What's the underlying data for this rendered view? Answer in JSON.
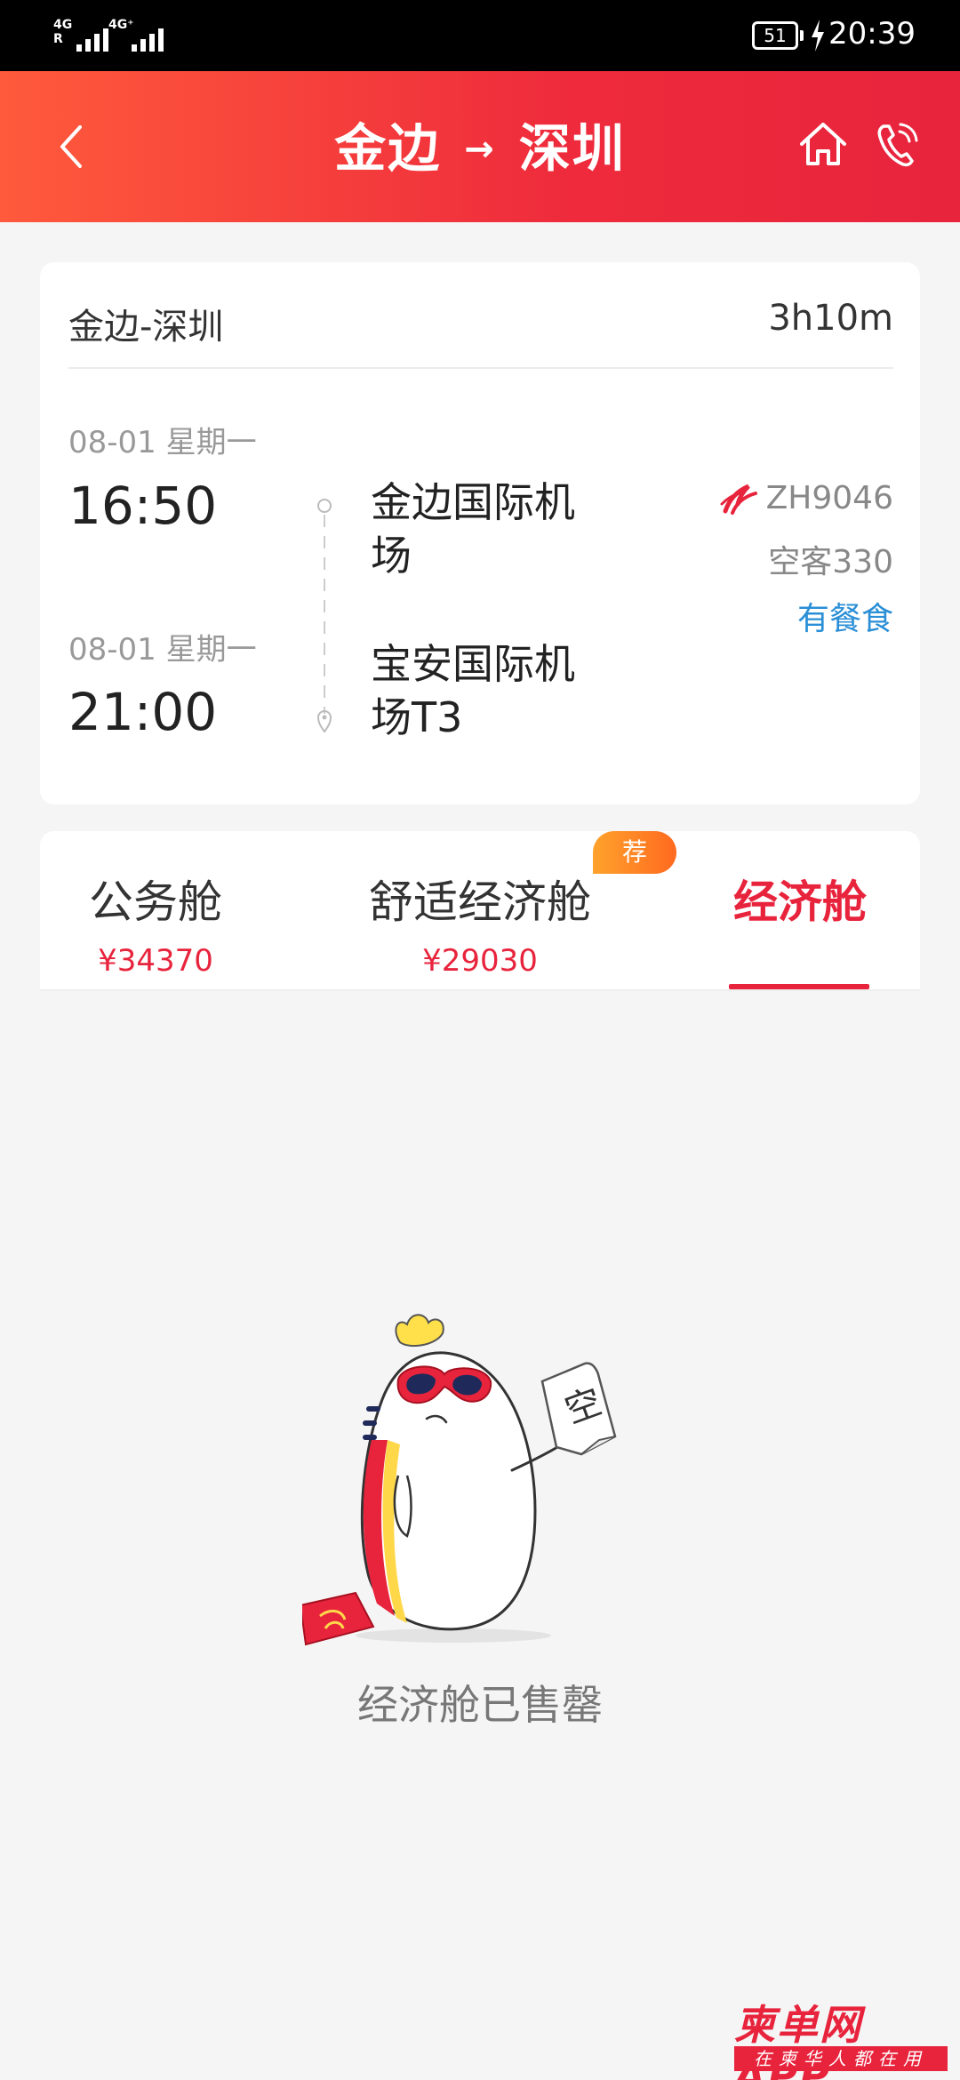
{
  "status_bar": {
    "signal1_label": "4G R",
    "signal2_label": "4G⁺",
    "battery": "51",
    "time": "20:39"
  },
  "header": {
    "origin": "金边",
    "arrow": "→",
    "destination": "深圳"
  },
  "flight": {
    "route": "金边-深圳",
    "duration": "3h10m",
    "departure": {
      "date": "08-01 星期一",
      "time": "16:50",
      "airport_line1": "金边国际机",
      "airport_line2": "场"
    },
    "arrival": {
      "date": "08-01 星期一",
      "time": "21:00",
      "airport_line1": "宝安国际机",
      "airport_line2": "场T3"
    },
    "flight_no": "ZH9046",
    "aircraft": "空客330",
    "meal": "有餐食"
  },
  "cabins": {
    "badge": "荐",
    "tabs": [
      {
        "name": "公务舱",
        "price": "¥34370"
      },
      {
        "name": "舒适经济舱",
        "price": "¥29030"
      },
      {
        "name": "经济舱",
        "price": ""
      }
    ]
  },
  "empty_state": {
    "sign_text": "空",
    "message": "经济舱已售罄"
  },
  "watermark": {
    "logo": "柬单网APP",
    "tagline": "在柬华人都在用"
  },
  "colors": {
    "brand_red": "#e8243d",
    "header_gradient_start": "#ff5a3c",
    "meal_blue": "#2a8fd6",
    "badge_orange": "#ff6a1f"
  }
}
